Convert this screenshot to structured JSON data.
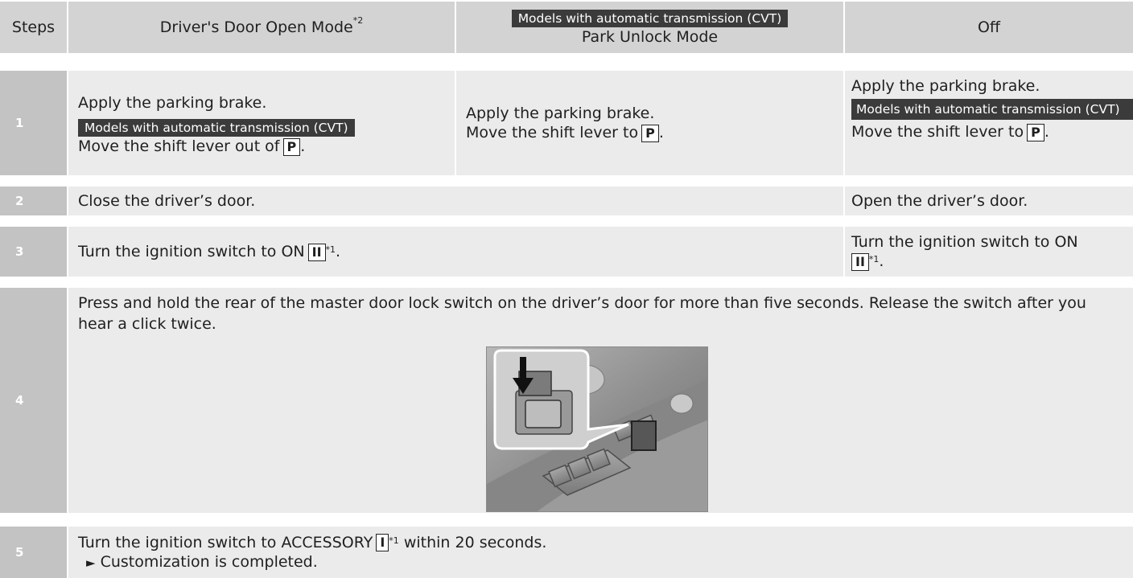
{
  "header": {
    "steps": "Steps",
    "col1": "Driver's Door Open Mode",
    "col1_note": "*2",
    "col2_tag": "Models with automatic transmission (CVT)",
    "col2": "Park Unlock Mode",
    "col3": "Off"
  },
  "rows": {
    "r1": {
      "num": "1",
      "c1_line1": "Apply the parking brake.",
      "c1_tag": "Models with automatic transmission (CVT)",
      "c1_line2": "Move the shift lever out of",
      "c1_key": "P",
      "c2_line1": "Apply the parking brake.",
      "c2_line2": "Move the shift lever to",
      "c2_key": "P",
      "c3_line1": "Apply the parking brake.",
      "c3_tag": "Models with automatic transmission (CVT)",
      "c3_line2": "Move the shift lever to",
      "c3_key": "P"
    },
    "r2": {
      "num": "2",
      "c12": "Close the driver’s door.",
      "c3": "Open the driver’s door."
    },
    "r3": {
      "num": "3",
      "c12": "Turn the ignition switch to ON",
      "c12_key": "II",
      "c12_note": "*1",
      "c3": "Turn the ignition switch to ON",
      "c3_key": "II",
      "c3_note": "*1"
    },
    "r4": {
      "num": "4",
      "text": "Press and hold the rear of the master door lock switch on the driver’s door for more than five seconds. Release the switch after you hear a click twice."
    },
    "r5": {
      "num": "5",
      "line1_pre": "Turn the ignition switch to ACCESSORY",
      "key": "I",
      "note": "*1",
      "line1_post": "within 20 seconds.",
      "line2": "Customization is completed.",
      "arrow": "►"
    }
  },
  "colors": {
    "header_bg": "#d3d3d3",
    "body_bg": "#ebebeb",
    "step_bg": "#c3c3c3",
    "tag_bg": "#3b3b3b"
  },
  "icons": [
    "door-switch-illustration",
    "down-arrow-icon",
    "triangle-bullet-icon"
  ]
}
